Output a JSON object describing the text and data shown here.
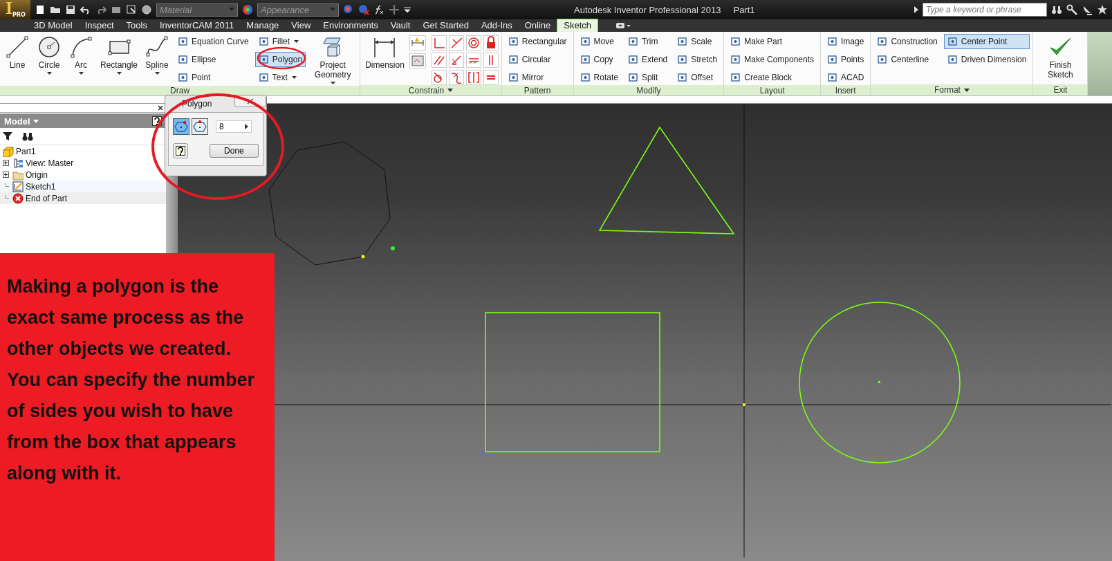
{
  "title_bar": {
    "app_logo": "I",
    "app_badge": "PRO",
    "material": "Material",
    "appearance": "Appearance",
    "title": "Autodesk Inventor Professional 2013",
    "document": "Part1",
    "search": {
      "placeholder": "Type a keyword or phrase"
    }
  },
  "tabs": [
    {
      "label": "3D Model",
      "selected": false
    },
    {
      "label": "Inspect",
      "selected": false
    },
    {
      "label": "Tools",
      "selected": false
    },
    {
      "label": "InventorCAM 2011",
      "selected": false
    },
    {
      "label": "Manage",
      "selected": false
    },
    {
      "label": "View",
      "selected": false
    },
    {
      "label": "Environments",
      "selected": false
    },
    {
      "label": "Vault",
      "selected": false
    },
    {
      "label": "Get Started",
      "selected": false
    },
    {
      "label": "Add-Ins",
      "selected": false
    },
    {
      "label": "Online",
      "selected": false
    },
    {
      "label": "Sketch",
      "selected": true
    }
  ],
  "ribbon": {
    "panels": [
      {
        "label": "Draw",
        "menu": false,
        "columns": [
          {
            "kind": "large",
            "label": "Line",
            "menu": false
          },
          {
            "kind": "large",
            "label": "Circle",
            "menu": true
          },
          {
            "kind": "large",
            "label": "Arc",
            "menu": true
          },
          {
            "kind": "large",
            "label": "Rectangle",
            "menu": true
          },
          {
            "kind": "large",
            "label": "Spline",
            "menu": true
          },
          {
            "kind": "stack",
            "tools": [
              {
                "label": "Equation Curve",
                "selected": false,
                "menu": false
              },
              {
                "label": "Ellipse",
                "selected": false,
                "menu": false
              },
              {
                "label": "Point",
                "selected": false,
                "menu": false
              }
            ]
          },
          {
            "kind": "stack",
            "tools": [
              {
                "label": "Fillet",
                "selected": false,
                "menu": true
              },
              {
                "label": "Polygon",
                "selected": true,
                "menu": false
              },
              {
                "label": "Text",
                "selected": false,
                "menu": true
              }
            ]
          },
          {
            "kind": "large",
            "label": "Project Geometry",
            "menu": true
          }
        ]
      },
      {
        "label": "Constrain",
        "menu": true,
        "columns": [
          {
            "kind": "large",
            "label": "Dimension",
            "menu": false
          },
          {
            "kind": "icon_grid"
          }
        ]
      },
      {
        "label": "Pattern",
        "menu": false,
        "columns": [
          {
            "kind": "stack",
            "tools": [
              {
                "label": "Rectangular",
                "selected": false,
                "menu": false
              },
              {
                "label": "Circular",
                "selected": false,
                "menu": false
              },
              {
                "label": "Mirror",
                "selected": false,
                "menu": false
              }
            ]
          }
        ]
      },
      {
        "label": "Modify",
        "menu": false,
        "columns": [
          {
            "kind": "stack",
            "tools": [
              {
                "label": "Move",
                "selected": false,
                "menu": false
              },
              {
                "label": "Copy",
                "selected": false,
                "menu": false
              },
              {
                "label": "Rotate",
                "selected": false,
                "menu": false
              }
            ]
          },
          {
            "kind": "stack",
            "tools": [
              {
                "label": "Trim",
                "selected": false,
                "menu": false
              },
              {
                "label": "Extend",
                "selected": false,
                "menu": false
              },
              {
                "label": "Split",
                "selected": false,
                "menu": false
              }
            ]
          },
          {
            "kind": "stack",
            "tools": [
              {
                "label": "Scale",
                "selected": false,
                "menu": false
              },
              {
                "label": "Stretch",
                "selected": false,
                "menu": false
              },
              {
                "label": "Offset",
                "selected": false,
                "menu": false
              }
            ]
          }
        ]
      },
      {
        "label": "Layout",
        "menu": false,
        "columns": [
          {
            "kind": "stack",
            "tools": [
              {
                "label": "Make Part",
                "selected": false,
                "menu": false
              },
              {
                "label": "Make Components",
                "selected": false,
                "menu": false
              },
              {
                "label": "Create Block",
                "selected": false,
                "menu": false
              }
            ]
          }
        ]
      },
      {
        "label": "Insert",
        "menu": false,
        "columns": [
          {
            "kind": "stack",
            "tools": [
              {
                "label": "Image",
                "selected": false,
                "menu": false
              },
              {
                "label": "Points",
                "selected": false,
                "menu": false
              },
              {
                "label": "ACAD",
                "selected": false,
                "menu": false
              }
            ]
          }
        ]
      },
      {
        "label": "Format",
        "menu": true,
        "columns": [
          {
            "kind": "stack",
            "tools": [
              {
                "label": "Construction",
                "selected": false,
                "menu": false
              },
              {
                "label": "Centerline",
                "selected": false,
                "menu": false
              }
            ]
          },
          {
            "kind": "stack",
            "tools": [
              {
                "label": "Center Point",
                "selected": true,
                "menu": false
              },
              {
                "label": "Driven Dimension",
                "selected": false,
                "menu": false
              }
            ]
          }
        ]
      },
      {
        "label": "Exit",
        "menu": false,
        "columns": [
          {
            "kind": "large",
            "label": "Finish Sketch",
            "menu": false
          }
        ]
      }
    ]
  },
  "browser": {
    "title": "Model",
    "tree": [
      {
        "label": "Part1",
        "expandable": false,
        "selected": false,
        "children": [
          {
            "label": "View: Master",
            "expandable": true,
            "selected": false
          },
          {
            "label": "Origin",
            "expandable": true,
            "selected": false
          },
          {
            "label": "Sketch1",
            "expandable": false,
            "selected": true
          },
          {
            "label": "End of Part",
            "expandable": false,
            "selected": false
          }
        ]
      }
    ]
  },
  "polygon_dialog": {
    "title": "Polygon",
    "modes": [
      {
        "kind": "inscribed",
        "selected": true
      },
      {
        "kind": "circumscribed",
        "selected": false
      }
    ],
    "sides": "8",
    "done": "Done"
  },
  "annotation": "Making a polygon is the exact same process as the other objects we created. You can specify the number of sides you wish to have from the box that appears along with it."
}
